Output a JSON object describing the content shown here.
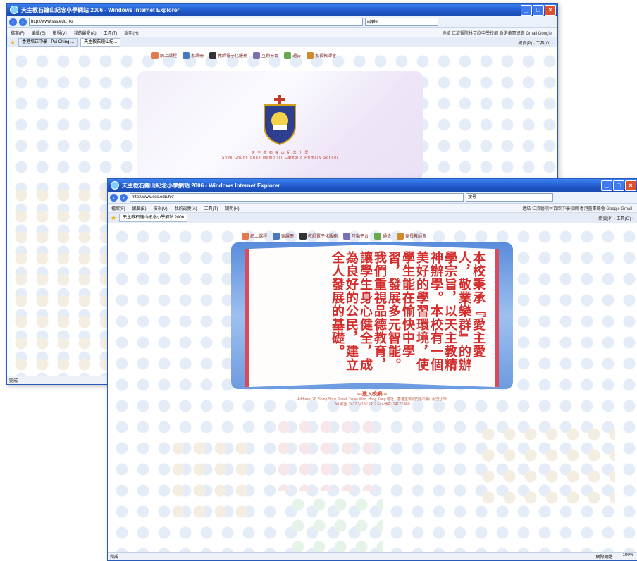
{
  "back_window": {
    "title": "天主教石鐘山紀念小學網站 2006 - Windows Internet Explorer",
    "url": "http://www.sss.edu.hk/",
    "search_value": "applet",
    "menu": [
      "檔案(F)",
      "編輯(E)",
      "檢視(V)",
      "我的最愛(A)",
      "工具(T)",
      "說明(H)"
    ],
    "links_label": "連結 仁濟醫院林百欣中學校網  香港童軍總會  Gmail  Google",
    "tabs": [
      "香港培正中學 - Pui Ching ...",
      "天主教石鐘山紀..."
    ],
    "tools_label": "網頁(P) · 工具(O) ·",
    "nav_items": [
      "網上課程",
      "家課冊",
      "教師電子化服務",
      "互動平台",
      "通告",
      "家長教師會"
    ],
    "school_name_line": "天 主 教 石 鐘 山 紀 念 小 學",
    "school_name_en": "Shek Chung Shan Memorial Catholic Primary School",
    "status_text": "完成"
  },
  "front_window": {
    "title": "天主教石鐘山紀念小學網站 2006 - Windows Internet Explorer",
    "url": "http://www.sss.edu.hk/",
    "search_value": "搜尋",
    "menu": [
      "檔案(F)",
      "編輯(E)",
      "檢視(V)",
      "我的最愛(A)",
      "工具(T)",
      "說明(H)"
    ],
    "links_label": "連結 仁濟醫院林百欣中學校網  香港童軍總會  Google  Gmail",
    "tabs": [
      "天主教石鐘山紀念小學網站 2006"
    ],
    "tools_label": "網頁(P) · 工具(O) ·",
    "nav_items": [
      "網上課程",
      "家課冊",
      "教師電子化服務",
      "互動平台",
      "通告",
      "家長教師會"
    ],
    "motto_text": "本校秉承『愛主愛人，敬業樂群』的辦學宗旨，以天主教精神辦學。本校有一個美好的學習環境，使學生能在愉快中學習，發展多元智能。我們重視品德教育，讓學生身心健全，成為良好的公民，建立全人發展的基礎。",
    "enter_label": "---進入校網---",
    "address_line": "Address: 26, Shing Shun Street, Tsuen Wan, Hong Kong  地址：香港荃灣城門道石鐘山紀念小學",
    "tel_line": "Tel 電話: 2412 1418 / 2412   Fax 傳真: 2412 1480",
    "status_text": "完成",
    "status_right": [
      "網際網路",
      "100%"
    ]
  }
}
